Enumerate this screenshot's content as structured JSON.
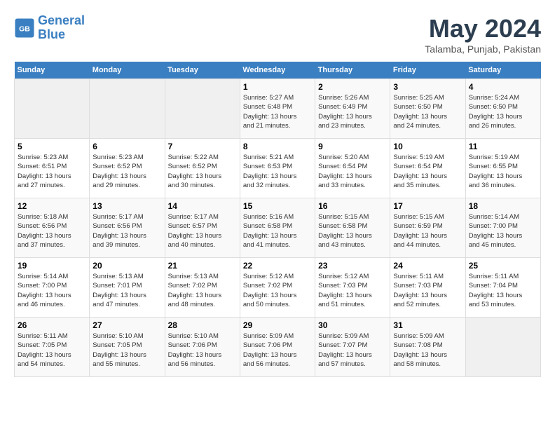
{
  "logo": {
    "line1": "General",
    "line2": "Blue"
  },
  "title": "May 2024",
  "location": "Talamba, Punjab, Pakistan",
  "days_of_week": [
    "Sunday",
    "Monday",
    "Tuesday",
    "Wednesday",
    "Thursday",
    "Friday",
    "Saturday"
  ],
  "weeks": [
    [
      {
        "day": "",
        "info": ""
      },
      {
        "day": "",
        "info": ""
      },
      {
        "day": "",
        "info": ""
      },
      {
        "day": "1",
        "info": "Sunrise: 5:27 AM\nSunset: 6:48 PM\nDaylight: 13 hours\nand 21 minutes."
      },
      {
        "day": "2",
        "info": "Sunrise: 5:26 AM\nSunset: 6:49 PM\nDaylight: 13 hours\nand 23 minutes."
      },
      {
        "day": "3",
        "info": "Sunrise: 5:25 AM\nSunset: 6:50 PM\nDaylight: 13 hours\nand 24 minutes."
      },
      {
        "day": "4",
        "info": "Sunrise: 5:24 AM\nSunset: 6:50 PM\nDaylight: 13 hours\nand 26 minutes."
      }
    ],
    [
      {
        "day": "5",
        "info": "Sunrise: 5:23 AM\nSunset: 6:51 PM\nDaylight: 13 hours\nand 27 minutes."
      },
      {
        "day": "6",
        "info": "Sunrise: 5:23 AM\nSunset: 6:52 PM\nDaylight: 13 hours\nand 29 minutes."
      },
      {
        "day": "7",
        "info": "Sunrise: 5:22 AM\nSunset: 6:52 PM\nDaylight: 13 hours\nand 30 minutes."
      },
      {
        "day": "8",
        "info": "Sunrise: 5:21 AM\nSunset: 6:53 PM\nDaylight: 13 hours\nand 32 minutes."
      },
      {
        "day": "9",
        "info": "Sunrise: 5:20 AM\nSunset: 6:54 PM\nDaylight: 13 hours\nand 33 minutes."
      },
      {
        "day": "10",
        "info": "Sunrise: 5:19 AM\nSunset: 6:54 PM\nDaylight: 13 hours\nand 35 minutes."
      },
      {
        "day": "11",
        "info": "Sunrise: 5:19 AM\nSunset: 6:55 PM\nDaylight: 13 hours\nand 36 minutes."
      }
    ],
    [
      {
        "day": "12",
        "info": "Sunrise: 5:18 AM\nSunset: 6:56 PM\nDaylight: 13 hours\nand 37 minutes."
      },
      {
        "day": "13",
        "info": "Sunrise: 5:17 AM\nSunset: 6:56 PM\nDaylight: 13 hours\nand 39 minutes."
      },
      {
        "day": "14",
        "info": "Sunrise: 5:17 AM\nSunset: 6:57 PM\nDaylight: 13 hours\nand 40 minutes."
      },
      {
        "day": "15",
        "info": "Sunrise: 5:16 AM\nSunset: 6:58 PM\nDaylight: 13 hours\nand 41 minutes."
      },
      {
        "day": "16",
        "info": "Sunrise: 5:15 AM\nSunset: 6:58 PM\nDaylight: 13 hours\nand 43 minutes."
      },
      {
        "day": "17",
        "info": "Sunrise: 5:15 AM\nSunset: 6:59 PM\nDaylight: 13 hours\nand 44 minutes."
      },
      {
        "day": "18",
        "info": "Sunrise: 5:14 AM\nSunset: 7:00 PM\nDaylight: 13 hours\nand 45 minutes."
      }
    ],
    [
      {
        "day": "19",
        "info": "Sunrise: 5:14 AM\nSunset: 7:00 PM\nDaylight: 13 hours\nand 46 minutes."
      },
      {
        "day": "20",
        "info": "Sunrise: 5:13 AM\nSunset: 7:01 PM\nDaylight: 13 hours\nand 47 minutes."
      },
      {
        "day": "21",
        "info": "Sunrise: 5:13 AM\nSunset: 7:02 PM\nDaylight: 13 hours\nand 48 minutes."
      },
      {
        "day": "22",
        "info": "Sunrise: 5:12 AM\nSunset: 7:02 PM\nDaylight: 13 hours\nand 50 minutes."
      },
      {
        "day": "23",
        "info": "Sunrise: 5:12 AM\nSunset: 7:03 PM\nDaylight: 13 hours\nand 51 minutes."
      },
      {
        "day": "24",
        "info": "Sunrise: 5:11 AM\nSunset: 7:03 PM\nDaylight: 13 hours\nand 52 minutes."
      },
      {
        "day": "25",
        "info": "Sunrise: 5:11 AM\nSunset: 7:04 PM\nDaylight: 13 hours\nand 53 minutes."
      }
    ],
    [
      {
        "day": "26",
        "info": "Sunrise: 5:11 AM\nSunset: 7:05 PM\nDaylight: 13 hours\nand 54 minutes."
      },
      {
        "day": "27",
        "info": "Sunrise: 5:10 AM\nSunset: 7:05 PM\nDaylight: 13 hours\nand 55 minutes."
      },
      {
        "day": "28",
        "info": "Sunrise: 5:10 AM\nSunset: 7:06 PM\nDaylight: 13 hours\nand 56 minutes."
      },
      {
        "day": "29",
        "info": "Sunrise: 5:09 AM\nSunset: 7:06 PM\nDaylight: 13 hours\nand 56 minutes."
      },
      {
        "day": "30",
        "info": "Sunrise: 5:09 AM\nSunset: 7:07 PM\nDaylight: 13 hours\nand 57 minutes."
      },
      {
        "day": "31",
        "info": "Sunrise: 5:09 AM\nSunset: 7:08 PM\nDaylight: 13 hours\nand 58 minutes."
      },
      {
        "day": "",
        "info": ""
      }
    ]
  ]
}
